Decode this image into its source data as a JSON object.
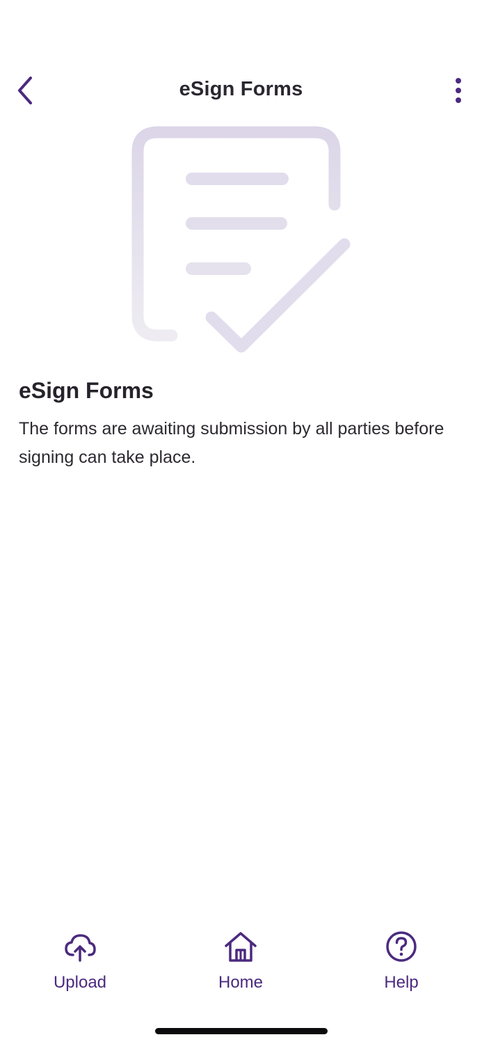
{
  "header": {
    "title": "eSign Forms",
    "back_icon": "chevron-left-icon",
    "more_icon": "more-vertical-icon"
  },
  "illustration": {
    "icon": "document-check-icon"
  },
  "content": {
    "title": "eSign Forms",
    "body": "The forms are awaiting submission by all parties before signing can take place."
  },
  "tabbar": {
    "tabs": [
      {
        "label": "Upload",
        "icon": "cloud-upload-icon"
      },
      {
        "label": "Home",
        "icon": "home-icon"
      },
      {
        "label": "Help",
        "icon": "help-circle-icon"
      }
    ]
  },
  "colors": {
    "accent": "#4b2a7f",
    "illustration": "#e3deec",
    "text": "#26232b",
    "background": "#ffffff"
  }
}
